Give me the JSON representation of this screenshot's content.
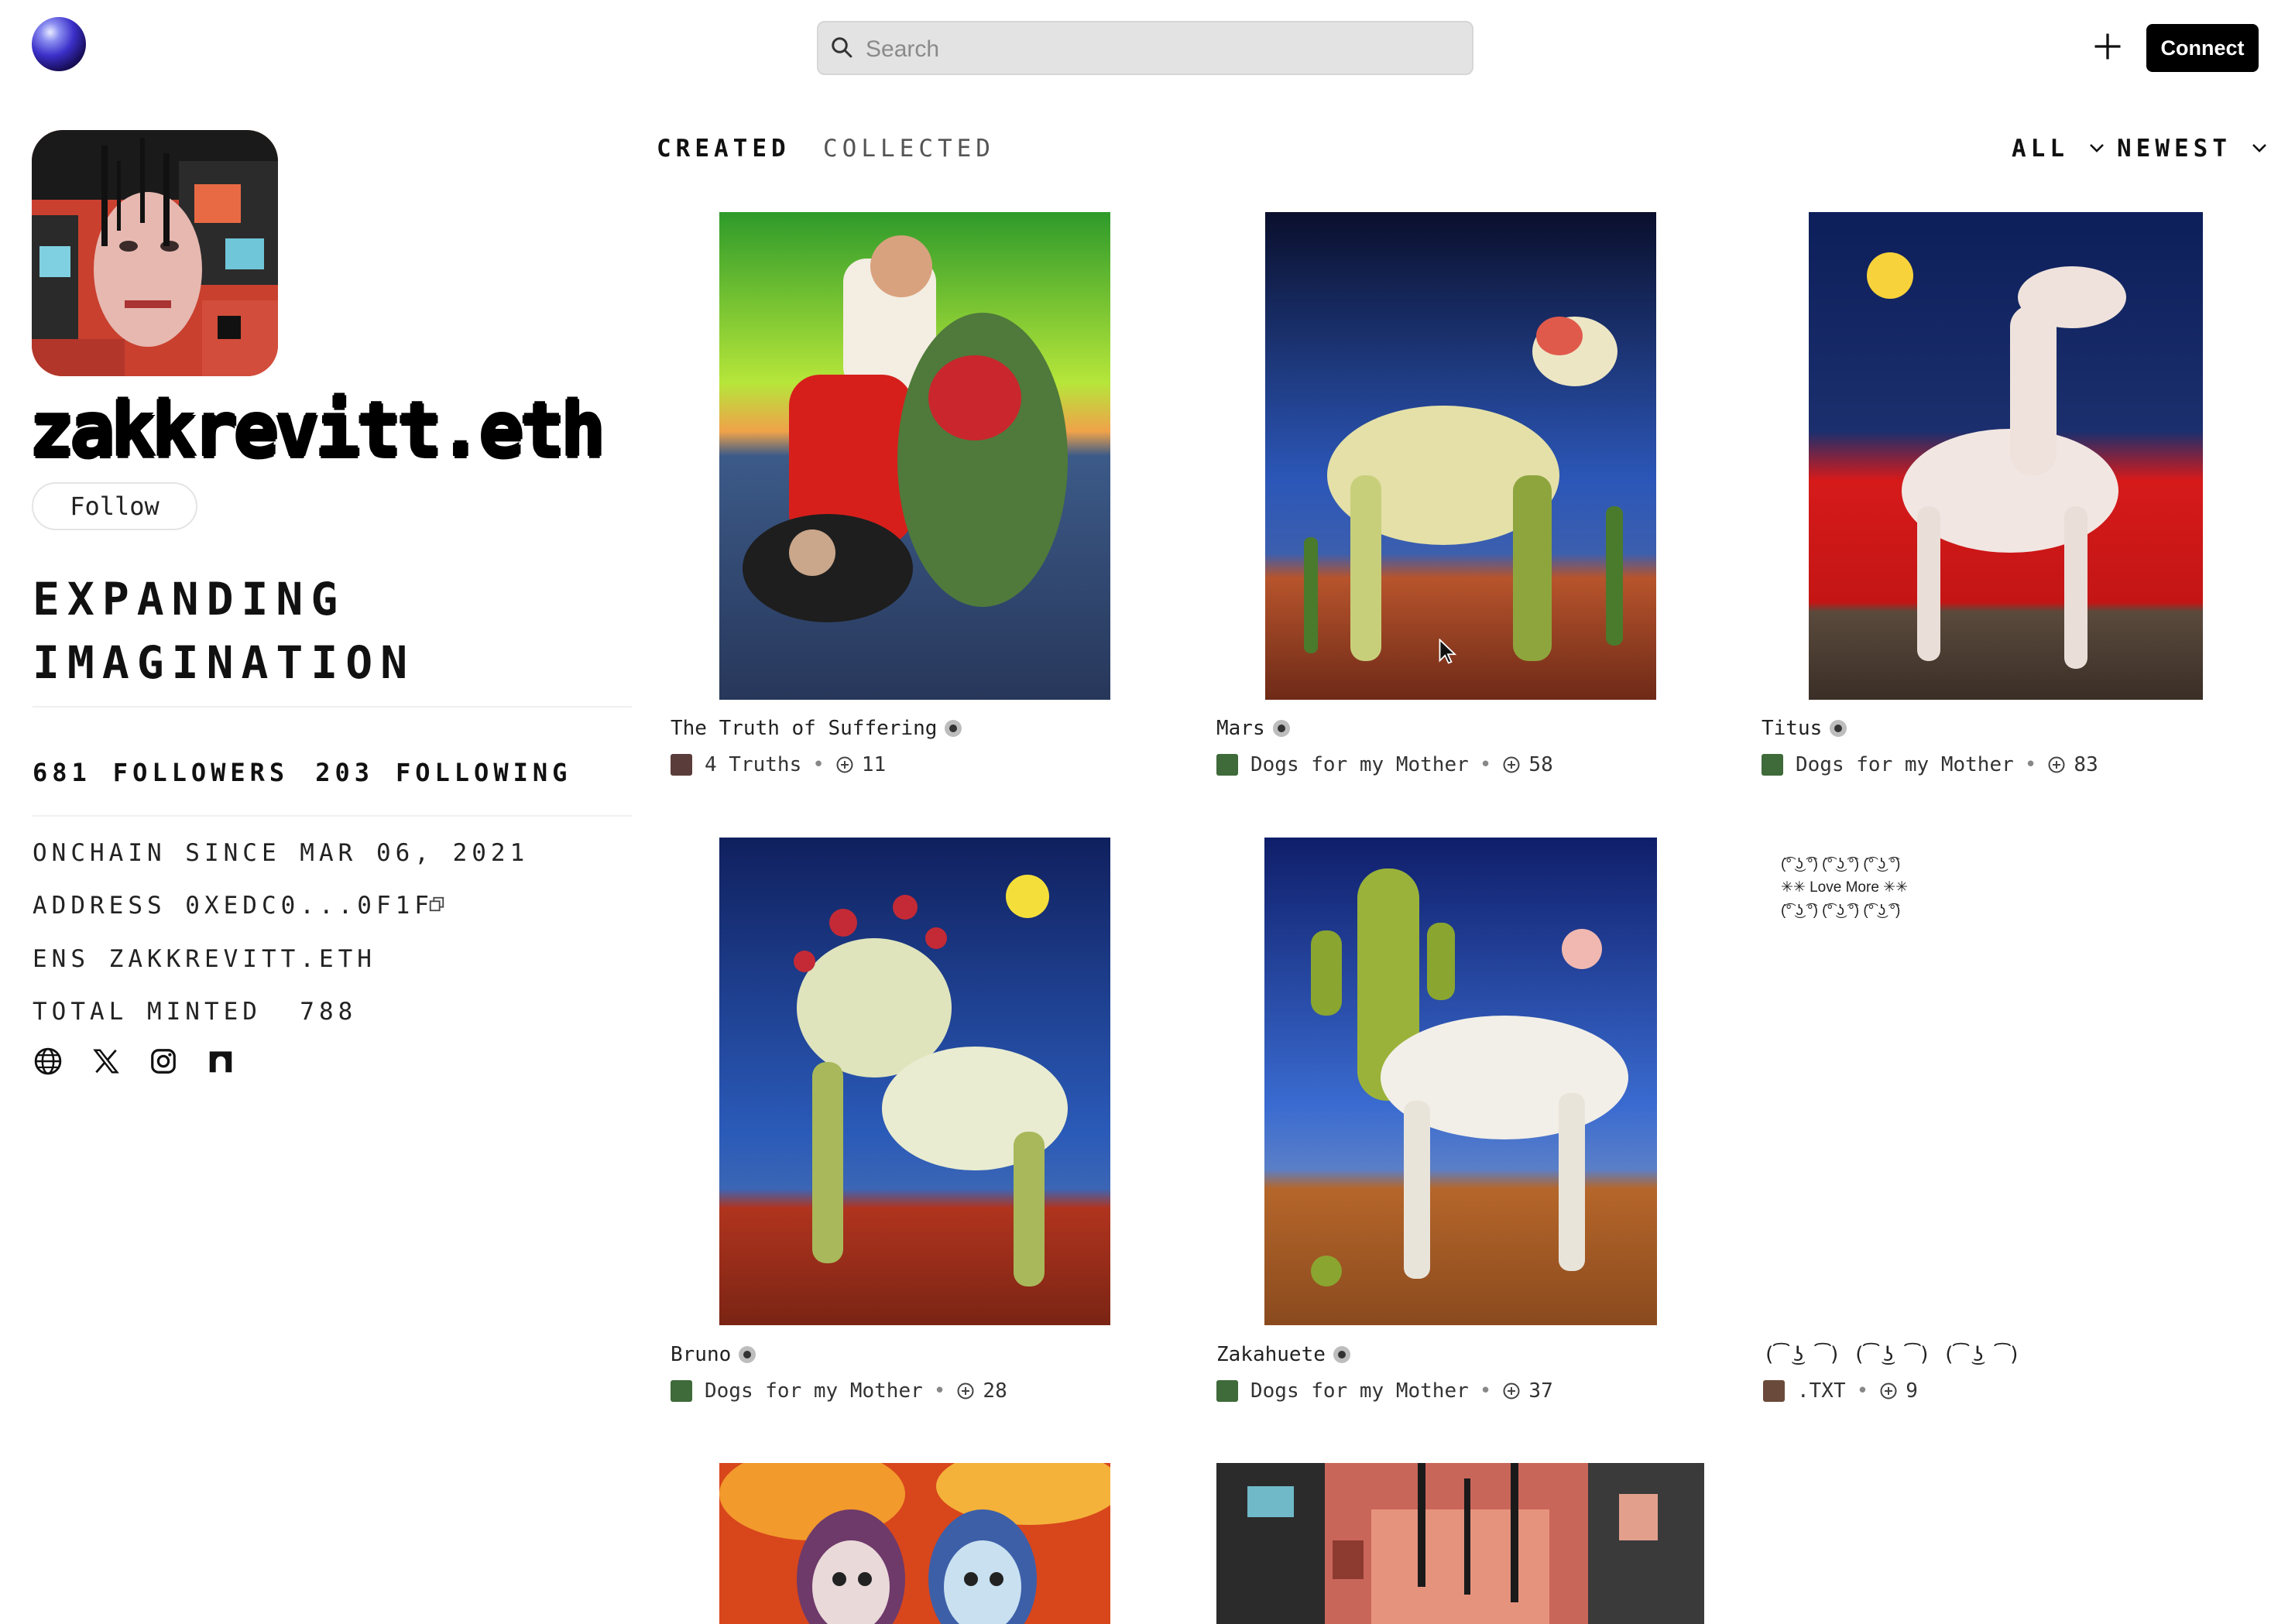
{
  "header": {
    "search_placeholder": "Search",
    "connect_label": "Connect"
  },
  "profile": {
    "username": "zakkrevitt.eth",
    "follow_label": "Follow",
    "bio_line1": "EXPANDING",
    "bio_line2": "IMAGINATION",
    "followers_count": "681",
    "followers_label": "FOLLOWERS",
    "following_count": "203",
    "following_label": "FOLLOWING",
    "onchain_since": "ONCHAIN SINCE MAR 06, 2021",
    "address": "ADDRESS 0XEDC0...0F1F",
    "ens": "ENS ZAKKREVITT.ETH",
    "total_minted_label": "TOTAL MINTED",
    "total_minted": "788",
    "social_icons": [
      "globe-icon",
      "x-icon",
      "instagram-icon",
      "arch-icon"
    ]
  },
  "tabs": {
    "created": "CREATED",
    "collected": "COLLECTED"
  },
  "filters": {
    "all": "ALL",
    "newest": "NEWEST"
  },
  "cards": [
    {
      "title": "The Truth of Suffering",
      "collection": "4 Truths",
      "count": "11"
    },
    {
      "title": "Mars",
      "collection": "Dogs for my Mother",
      "count": "58"
    },
    {
      "title": "Titus",
      "collection": "Dogs for my Mother",
      "count": "83"
    },
    {
      "title": "Bruno",
      "collection": "Dogs for my Mother",
      "count": "28"
    },
    {
      "title": "Zakahuete",
      "collection": "Dogs for my Mother",
      "count": "37"
    },
    {
      "title": "(͡ ͜ʖ ͡) (͡ ͜ʖ ͡) (͡ ͜ʖ ͡)",
      "collection": ".TXT",
      "count": "9"
    }
  ],
  "txt_art": {
    "line1": "(͡° ͜ʖ ͡°) (͡° ͜ʖ ͡°) (͡° ͜ʖ ͡°)",
    "line2": "✳✳ Love More ✳✳",
    "line3": "(͡° ͜ʖ ͡°) (͡° ͜ʖ ͡°) (͡° ͜ʖ ͡°)"
  },
  "colors": {
    "accent": "#000000",
    "search_bg": "#e3e3e3"
  }
}
